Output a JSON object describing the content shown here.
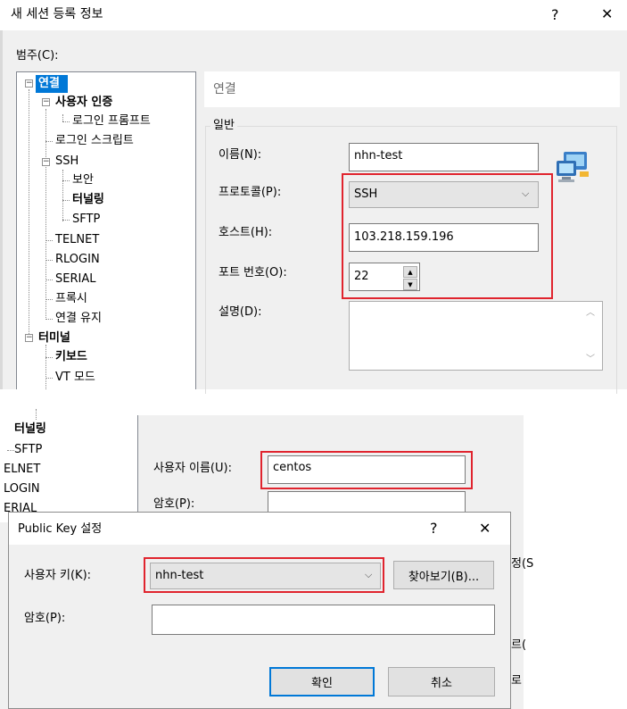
{
  "top_dialog": {
    "title": "새 세션 등록 정보",
    "help": "?",
    "close": "✕",
    "category_label": "범주(C):",
    "tree": [
      {
        "label": "연결",
        "bold": true,
        "selected": true
      },
      {
        "label": "사용자 인증",
        "bold": true
      },
      {
        "label": "로그인 프롬프트"
      },
      {
        "label": "로그인 스크립트"
      },
      {
        "label": "SSH"
      },
      {
        "label": "보안"
      },
      {
        "label": "터널링",
        "bold": true
      },
      {
        "label": "SFTP"
      },
      {
        "label": "TELNET"
      },
      {
        "label": "RLOGIN"
      },
      {
        "label": "SERIAL"
      },
      {
        "label": "프록시"
      },
      {
        "label": "연결 유지"
      },
      {
        "label": "터미널",
        "bold": true
      },
      {
        "label": "키보드",
        "bold": true
      },
      {
        "label": "VT 모드"
      }
    ],
    "section_header": "연결",
    "group_label": "일반",
    "name_label": "이름(N):",
    "name_value": "nhn-test",
    "protocol_label": "프로토콜(P):",
    "protocol_value": "SSH",
    "host_label": "호스트(H):",
    "host_value": "103.218.159.196",
    "port_label": "포트 번호(O):",
    "port_value": "22",
    "desc_label": "설명(D):"
  },
  "bottom_window": {
    "tree": [
      {
        "label": "터널링",
        "bold": true
      },
      {
        "label": "SFTP"
      },
      {
        "label": "ELNET"
      },
      {
        "label": "LOGIN"
      },
      {
        "label": "ERIAL"
      }
    ],
    "username_label": "사용자 이름(U):",
    "username_value": "centos",
    "password_label": "암호(P):",
    "edge_texts": [
      "정(S",
      "르(",
      "로"
    ]
  },
  "pk_dialog": {
    "title": "Public Key 설정",
    "help": "?",
    "close": "✕",
    "user_key_label": "사용자 키(K):",
    "user_key_value": "nhn-test",
    "browse_label": "찾아보기(B)...",
    "password_label": "암호(P):",
    "password_value": "",
    "ok_label": "확인",
    "cancel_label": "취소"
  }
}
